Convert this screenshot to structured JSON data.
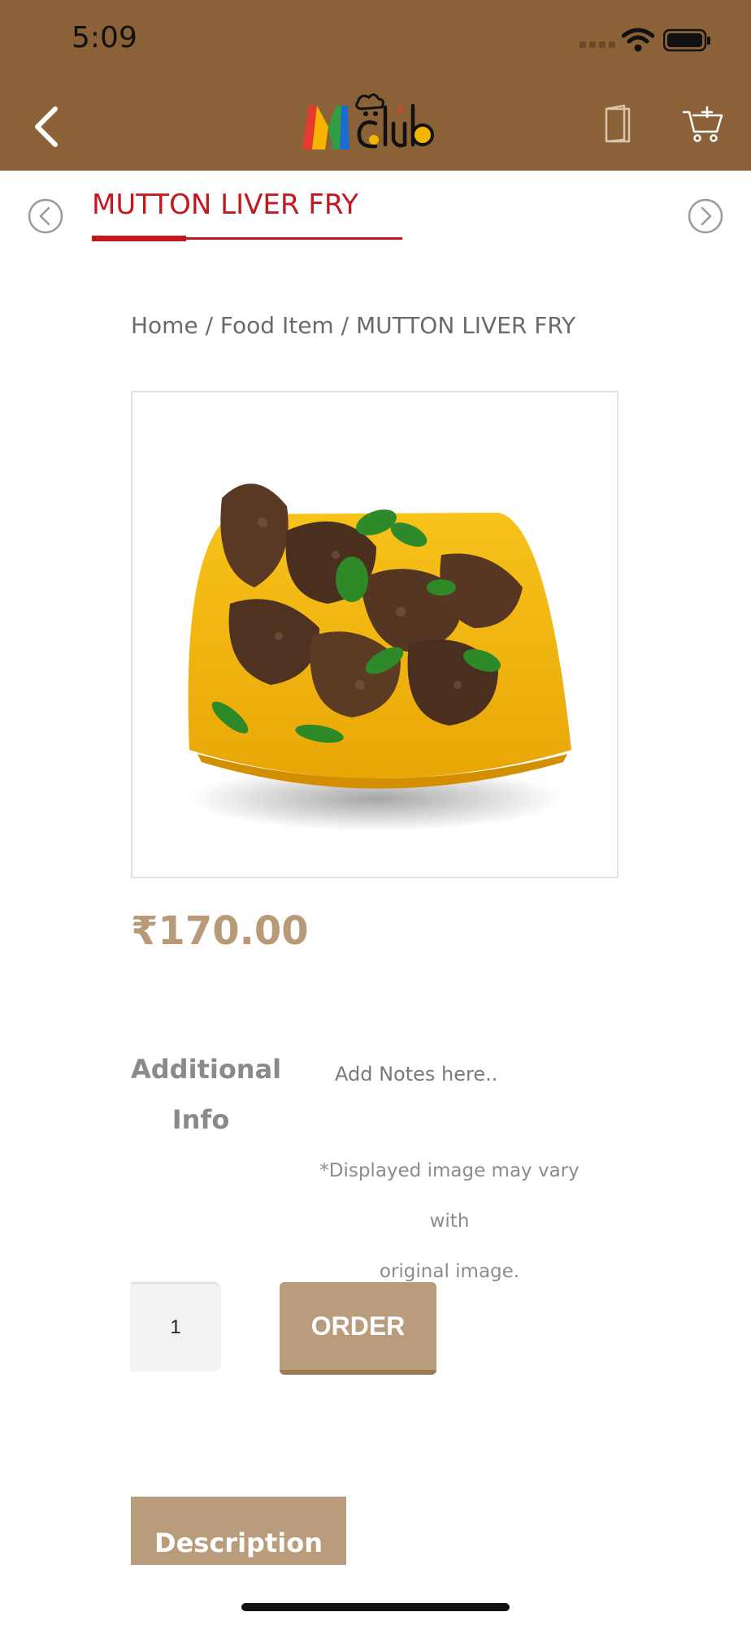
{
  "status_bar": {
    "time": "5:09"
  },
  "header": {
    "logo_text": "MClub",
    "brand_colors": [
      "#e63a2f",
      "#f4b400",
      "#2f9e44",
      "#1c6bd1",
      "#111111"
    ]
  },
  "item_tab": {
    "title": "MUTTON LIVER FRY"
  },
  "breadcrumb": {
    "items": [
      "Home",
      "Food Item",
      "MUTTON LIVER FRY"
    ],
    "separator": " / "
  },
  "product": {
    "price": "₹170.00"
  },
  "additional_info": {
    "label_line1": "Additional",
    "label_line2": "Info",
    "placeholder": "Add Notes here..",
    "disclaimer_line1": "*Displayed image may vary with",
    "disclaimer_line2": "original image."
  },
  "order": {
    "quantity": "1",
    "button_label": "ORDER"
  },
  "tabs": {
    "description_label": "Description"
  },
  "colors": {
    "header_bg": "#8b6237",
    "accent_red": "#c4171f",
    "tan": "#b89c7b"
  }
}
